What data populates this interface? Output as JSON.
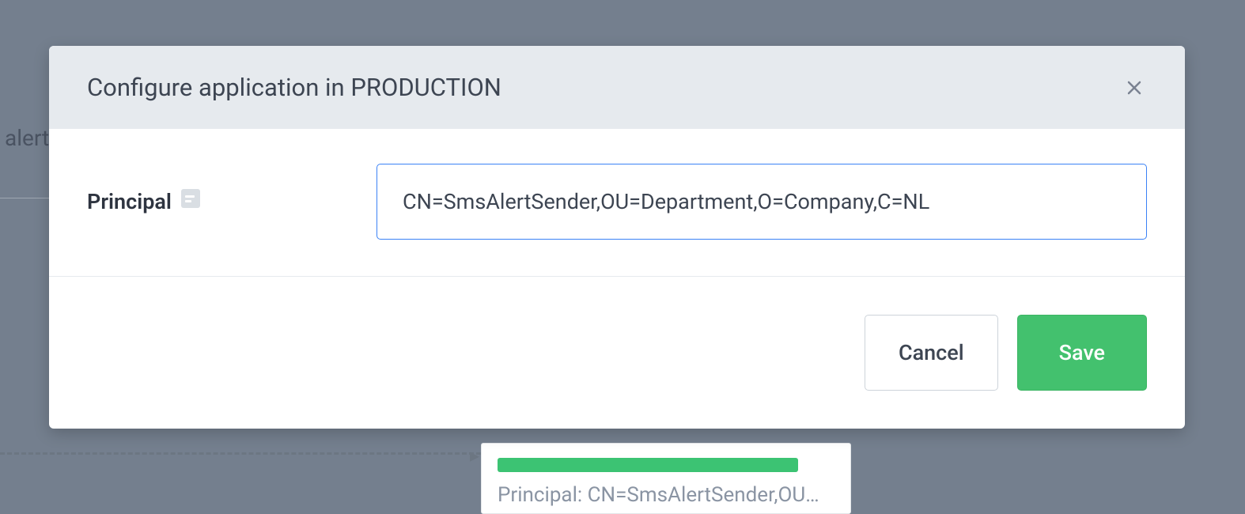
{
  "background": {
    "side_text": "alert",
    "panel_principal": "Principal: CN=SmsAlertSender,OU…"
  },
  "modal": {
    "title": "Configure application in PRODUCTION",
    "field_label": "Principal",
    "principal_value": "CN=SmsAlertSender,OU=Department,O=Company,C=NL",
    "cancel_label": "Cancel",
    "save_label": "Save"
  }
}
